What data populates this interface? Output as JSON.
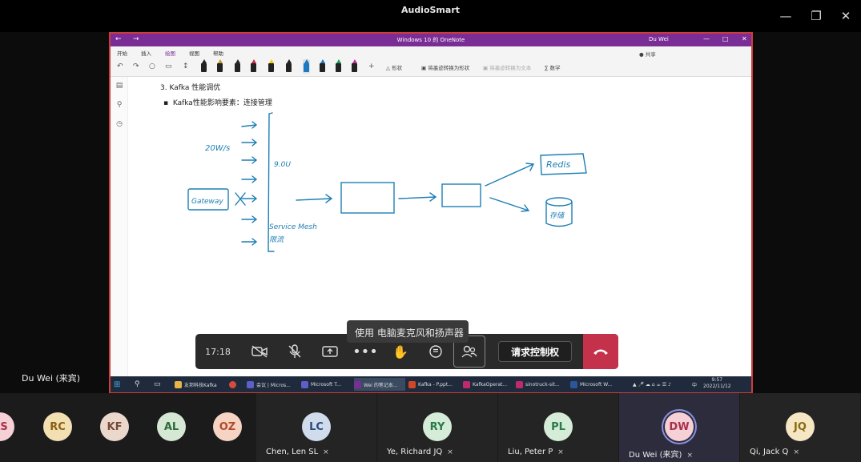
{
  "window": {
    "title": "AudioSmart"
  },
  "onenote": {
    "title": "Windows 10 的 OneNote",
    "user": "Du Wei",
    "tabs": [
      "开始",
      "插入",
      "绘图",
      "视图",
      "帮助"
    ],
    "active_tab": "绘图",
    "ribbon": {
      "shapes": "形状",
      "ink_to_shape": "将墨迹转换为形状",
      "ink_to_text": "将墨迹转换为文本",
      "math": "数学",
      "share": "共享"
    },
    "pen_colors": [
      "#222222",
      "#c59a2a",
      "#2a2a2a",
      "#d12a4a",
      "#f0d000",
      "#222222",
      "#1a7ac4",
      "#1a7ac4",
      "#1aa060",
      "#c02aa0"
    ],
    "heading": "3.  Kafka 性能调优",
    "bullet": "Kafka性能影响要素：连接管理",
    "ink_labels": {
      "rate": "20W/s",
      "gateway": "Gateway",
      "num": "9.0U",
      "mesh": "Service Mesh",
      "mesh2": "限流",
      "redis": "Redis",
      "store": "存储"
    },
    "ink_color": "#1d7fb4"
  },
  "call": {
    "timer": "17:18",
    "tooltip": "使用 电脑麦克风和扬声器",
    "request_control": "请求控制权",
    "hangup_color": "#c4314b"
  },
  "taskbar": {
    "items": [
      "友邦科技Kafka",
      "会议 | Micros...",
      "Microsoft T...",
      "Wei 的笔记本...",
      "Kafka - P.ppt...",
      "KafkaOperat...",
      "sinotruck-sit...",
      "Microsoft W..."
    ],
    "time": "9:57",
    "date": "2022/11/12",
    "ime": "中"
  },
  "presenter": "Du Wei (来宾)",
  "participants": [
    {
      "initials": "KS",
      "name": "",
      "bg": "#f5d0d6",
      "fg": "#a8324a"
    },
    {
      "initials": "RC",
      "name": "",
      "bg": "#f2e0b2",
      "fg": "#8a5e10"
    },
    {
      "initials": "KF",
      "name": "",
      "bg": "#ead8cc",
      "fg": "#7a4a3a"
    },
    {
      "initials": "AL",
      "name": "",
      "bg": "#d4e8d4",
      "fg": "#2e6a3a"
    },
    {
      "initials": "OZ",
      "name": "",
      "bg": "#f5d4c4",
      "fg": "#b24a2a"
    },
    {
      "initials": "LC",
      "name": "Chen, Len SL",
      "bg": "#d0dcec",
      "fg": "#2a4a7a"
    },
    {
      "initials": "RY",
      "name": "Ye, Richard JQ",
      "bg": "#d4ecd8",
      "fg": "#2a7a4a"
    },
    {
      "initials": "PL",
      "name": "Liu, Peter P",
      "bg": "#d4ecd8",
      "fg": "#2a7a4a"
    },
    {
      "initials": "DW",
      "name": "Du Wei (来宾)",
      "bg": "#f5d0d6",
      "fg": "#a8324a"
    },
    {
      "initials": "JQ",
      "name": "Qi, Jack Q",
      "bg": "#f5e6c4",
      "fg": "#8a6a10"
    }
  ]
}
